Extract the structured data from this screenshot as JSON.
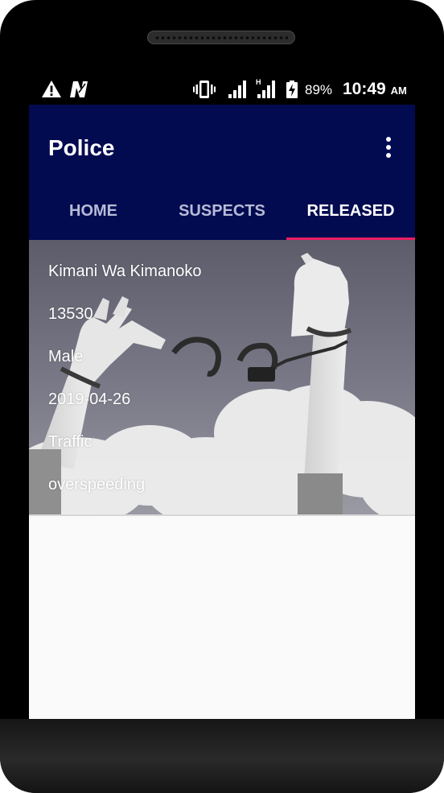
{
  "status_bar": {
    "warning_icon": "warning-icon",
    "notification_icon": "n-notification-icon",
    "vibrate_icon": "vibrate-icon",
    "signal_icon": "signal-icon",
    "network_type": "H",
    "battery_icon": "battery-charging-icon",
    "battery_percent": "89%",
    "time": "10:49",
    "am_pm": "AM"
  },
  "app_bar": {
    "title": "Police",
    "menu_icon": "more-vert-icon",
    "background": "#020a50"
  },
  "tabs": [
    {
      "label": "HOME",
      "active": false
    },
    {
      "label": "SUSPECTS",
      "active": false
    },
    {
      "label": "RELEASED",
      "active": true
    }
  ],
  "accent_color": "#e91e63",
  "released_list": [
    {
      "name": "Kimani Wa Kimanoko",
      "id": "13530",
      "gender": "Male",
      "date": "2019-04-26",
      "category": "Traffic",
      "offence": "overspeeding",
      "background_image": "broken-handcuffs-raised-hands"
    }
  ]
}
